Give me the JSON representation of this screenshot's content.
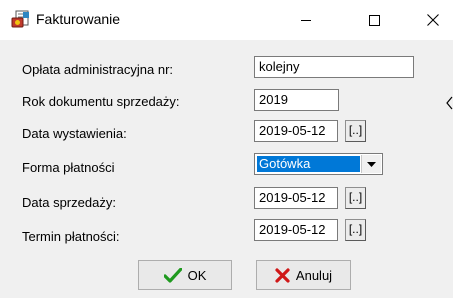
{
  "window": {
    "title": "Fakturowanie",
    "minimize_icon": "minimize-icon",
    "maximize_icon": "maximize-icon",
    "close_icon": "close-icon"
  },
  "form": {
    "nr_label": "Opłata administracyjna nr:",
    "nr_value": "kolejny",
    "rok_label": "Rok dokumentu sprzedaży:",
    "rok_value": "2019",
    "wyst_label": "Data wystawienia:",
    "wyst_value": "2019-05-12",
    "forma_label": "Forma płatności",
    "forma_value": "Gotówka",
    "sprz_label": "Data sprzedaży:",
    "sprz_value": "2019-05-12",
    "termin_label": "Termin płatności:",
    "termin_value": "2019-05-12",
    "picker_label": "[..]"
  },
  "buttons": {
    "ok_label": "OK",
    "cancel_label": "Anuluj"
  },
  "colors": {
    "selection": "#0078d7",
    "ok_check": "#1f9a1f",
    "cancel_x": "#d01818"
  }
}
